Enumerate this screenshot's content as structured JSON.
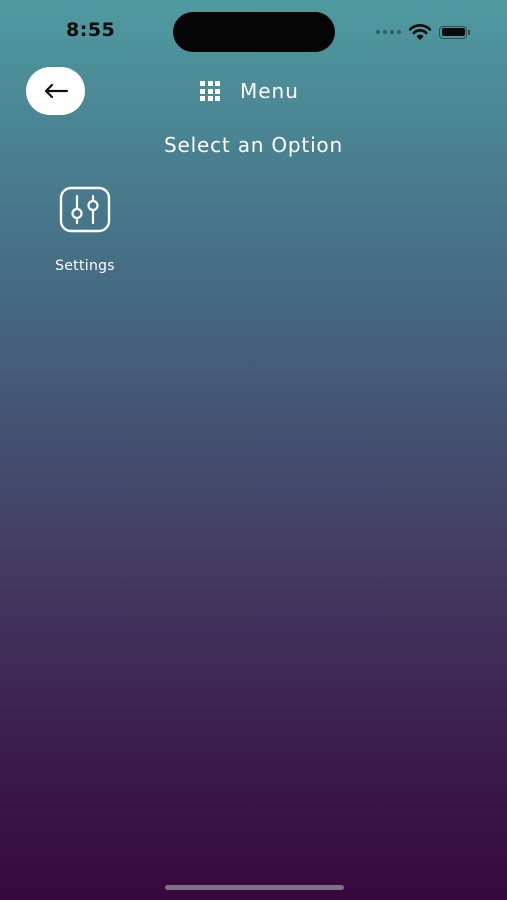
{
  "status_bar": {
    "time": "8:55",
    "icons": [
      "signal-icon",
      "wifi-icon",
      "battery-icon"
    ]
  },
  "header": {
    "back_icon": "arrow-left-icon",
    "menu_icon": "grid-icon",
    "title": "Menu"
  },
  "main": {
    "subtitle": "Select an Option",
    "options": [
      {
        "label": "Settings",
        "icon": "sliders-icon"
      }
    ]
  },
  "colors": {
    "gradient_top": "#4f9aa0",
    "gradient_bottom": "#36093d",
    "back_button_bg": "#ffffff",
    "text": "#ffffff"
  }
}
